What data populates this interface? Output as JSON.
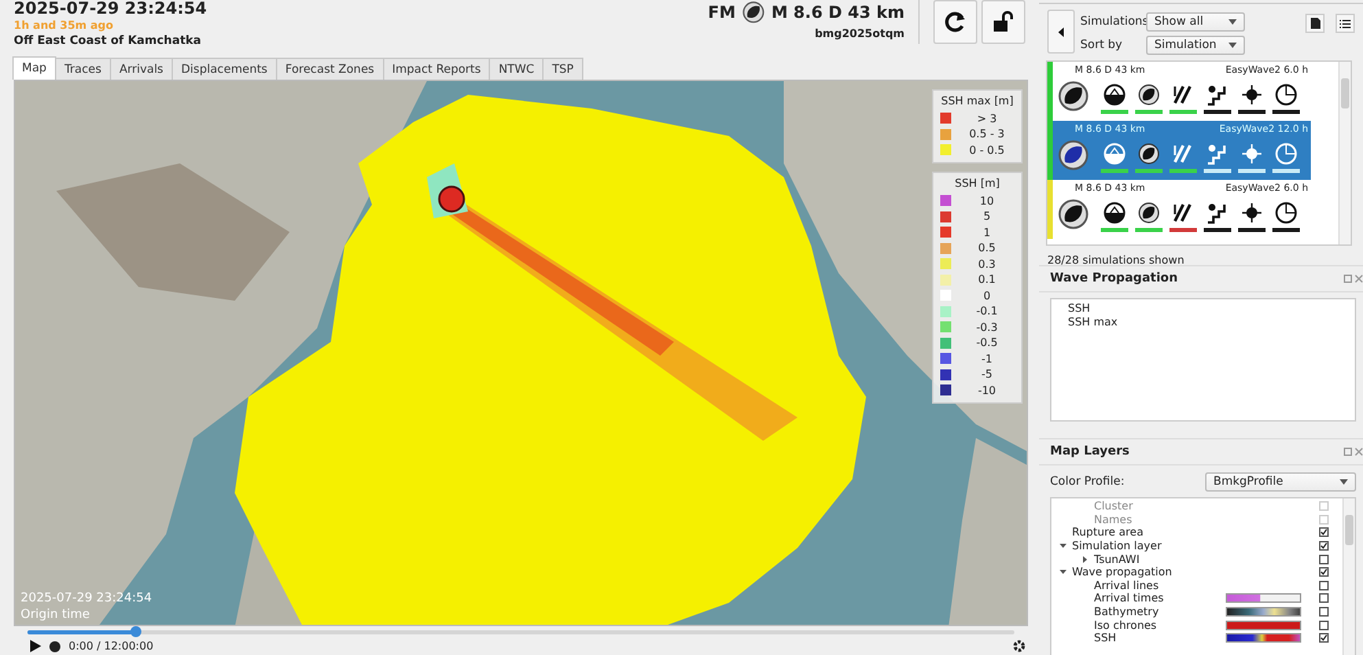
{
  "header": {
    "title": "2025-07-29 23:24:54",
    "age": "1h and 35m ago",
    "region": "Off East Coast of Kamchatka",
    "event_type": "FM",
    "magnitude_depth": "M 8.6  D 43 km",
    "event_id": "bmg2025otqm"
  },
  "tabs": [
    {
      "label": "Map",
      "selected": true
    },
    {
      "label": "Traces",
      "selected": false
    },
    {
      "label": "Arrivals",
      "selected": false
    },
    {
      "label": "Displacements",
      "selected": false
    },
    {
      "label": "Forecast Zones",
      "selected": false
    },
    {
      "label": "Impact Reports",
      "selected": false
    },
    {
      "label": "NTWC",
      "selected": false
    },
    {
      "label": "TSP",
      "selected": false
    }
  ],
  "map": {
    "time": "2025-07-29 23:24:54",
    "time_label": "Origin time",
    "legend_max": {
      "title": "SSH max [m]",
      "entries": [
        {
          "label": "> 3",
          "color": "#e23b2c"
        },
        {
          "label": "0.5 - 3",
          "color": "#e8a23e"
        },
        {
          "label": "0 - 0.5",
          "color": "#f2ef2e"
        }
      ]
    },
    "legend_ssh": {
      "title": "SSH [m]",
      "entries": [
        {
          "label": "10",
          "color": "#c44fd2"
        },
        {
          "label": "5",
          "color": "#dc3a30"
        },
        {
          "label": "1",
          "color": "#e5392a"
        },
        {
          "label": "0.5",
          "color": "#e6a458"
        },
        {
          "label": "0.3",
          "color": "#ecec56"
        },
        {
          "label": "0.1",
          "color": "#f3f0a8"
        },
        {
          "label": "0",
          "color": "#ffffff"
        },
        {
          "label": "-0.1",
          "color": "#a8f2c6"
        },
        {
          "label": "-0.3",
          "color": "#74e070"
        },
        {
          "label": "-0.5",
          "color": "#42c078"
        },
        {
          "label": "-1",
          "color": "#5656e2"
        },
        {
          "label": "-5",
          "color": "#3232b4"
        },
        {
          "label": "-10",
          "color": "#2e2e92"
        }
      ]
    }
  },
  "player": {
    "position": "0:00 / 12:00:00",
    "level": 0.11
  },
  "simulations": {
    "filter_label": "Simulations",
    "filter": "Show all",
    "sort_label": "Sort by",
    "sort": "Simulation",
    "rows": [
      {
        "magnitude_depth": "M 8.6  D  43  km",
        "model": "EasyWave2 6.0 h",
        "color": "#2ecc3a",
        "selected": false,
        "statuses": [
          {
            "color": "#3ad24a"
          },
          {
            "color": "#3ad24a"
          },
          {
            "color": "#3ad24a"
          },
          {
            "color": "#1a1a1a"
          },
          {
            "color": "#1a1a1a"
          },
          {
            "color": "#1a1a1a"
          }
        ]
      },
      {
        "magnitude_depth": "M 8.6  D  43  km",
        "model": "EasyWave2 12.0 h",
        "color": "#2ecc3a",
        "selected": true,
        "statuses": [
          {
            "color": "#3ad24a"
          },
          {
            "color": "#3ad24a"
          },
          {
            "color": "#3ad24a"
          },
          {
            "color": "#c9eaf6"
          },
          {
            "color": "#c9eaf6"
          },
          {
            "color": "#c9eaf6"
          }
        ]
      },
      {
        "magnitude_depth": "M 8.6  D  43  km",
        "model": "EasyWave2 6.0 h",
        "color": "#e8e030",
        "selected": false,
        "statuses": [
          {
            "color": "#3ad24a"
          },
          {
            "color": "#3ad24a"
          },
          {
            "color": "#d23a3a"
          },
          {
            "color": "#1a1a1a"
          },
          {
            "color": "#1a1a1a"
          },
          {
            "color": "#1a1a1a"
          }
        ]
      }
    ],
    "count": "28/28 simulations shown"
  },
  "wave_propagation": {
    "title": "Wave Propagation",
    "items": [
      "SSH",
      "SSH max"
    ]
  },
  "map_layers": {
    "title": "Map Layers",
    "profile_label": "Color Profile:",
    "profile": "BmkgProfile",
    "tree": [
      {
        "children": [
          {
            "label": "Cluster",
            "checked": false,
            "disabled": true
          },
          {
            "label": "Names",
            "checked": false,
            "disabled": true
          }
        ]
      },
      {
        "label": "Rupture area",
        "checked": true,
        "disabled": false
      },
      {
        "label": "Simulation layer",
        "checked": true,
        "disabled": false,
        "expanded": true,
        "children": [
          {
            "label": "TsunAWI",
            "checked": false,
            "disabled": false,
            "expanded": false
          }
        ]
      },
      {
        "label": "Wave propagation",
        "checked": true,
        "disabled": false,
        "expanded": true,
        "children": [
          {
            "label": "Arrival lines",
            "checked": false,
            "disabled": false
          },
          {
            "label": "Arrival times",
            "checked": false,
            "disabled": false,
            "kind": "magenta"
          },
          {
            "label": "Bathymetry",
            "checked": false,
            "disabled": false,
            "kind": "terrain"
          },
          {
            "label": "Iso chrones",
            "checked": false,
            "disabled": false,
            "kind": "solid"
          },
          {
            "label": "SSH",
            "checked": true,
            "disabled": false,
            "kind": "diverging"
          }
        ]
      }
    ]
  }
}
